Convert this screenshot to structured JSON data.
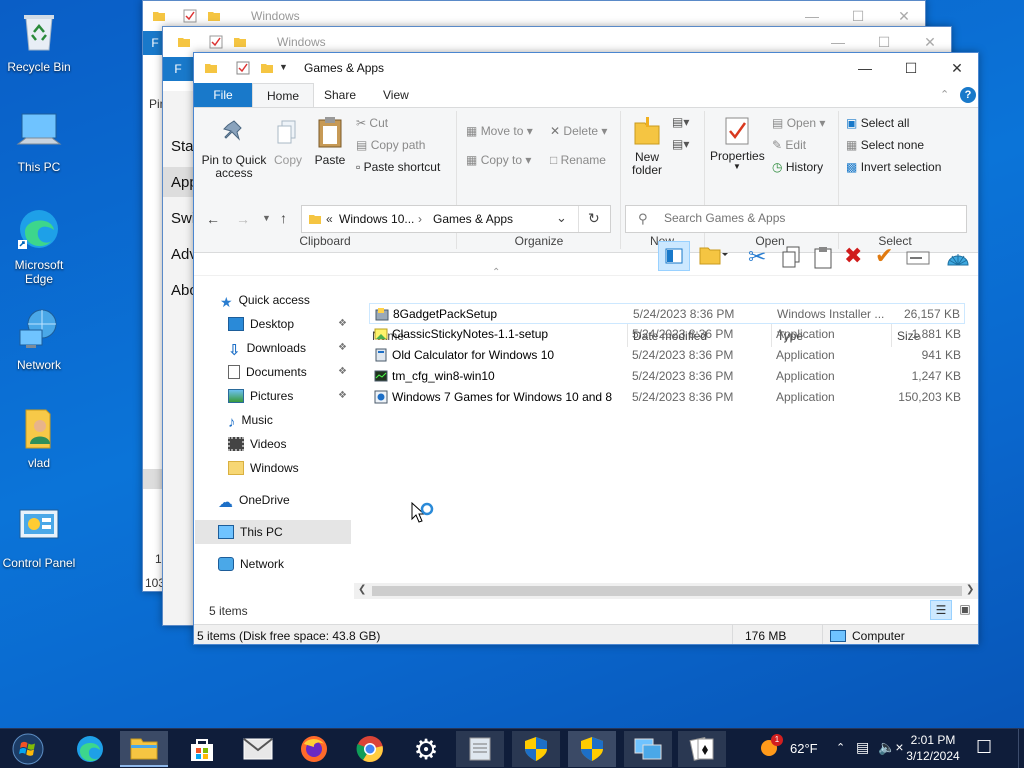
{
  "desktop": {
    "icons": [
      {
        "name": "recycle-bin",
        "label": "Recycle Bin"
      },
      {
        "name": "this-pc",
        "label": "This PC"
      },
      {
        "name": "microsoft-edge",
        "label": "Microsoft Edge"
      },
      {
        "name": "network",
        "label": "Network"
      },
      {
        "name": "vlad",
        "label": "vlad"
      },
      {
        "name": "control-panel",
        "label": "Control Panel"
      }
    ]
  },
  "background_windows": [
    {
      "title": "Windows"
    },
    {
      "title": "Windows"
    }
  ],
  "background_sidebar": {
    "items": [
      "Star",
      "App",
      "Swi",
      "Adv",
      "Abo"
    ],
    "partial_numbers": [
      "1",
      "103"
    ],
    "pin_label": "Pin",
    "file_tab_stub": "F"
  },
  "explorer": {
    "title": "Games & Apps",
    "ribbon_tabs": [
      "File",
      "Home",
      "Share",
      "View"
    ],
    "clipboard": {
      "pin_to_quick_access": "Pin to Quick access",
      "copy": "Copy",
      "paste": "Paste",
      "cut": "Cut",
      "copy_path": "Copy path",
      "paste_shortcut": "Paste shortcut",
      "group_label": "Clipboard"
    },
    "organize": {
      "move_to": "Move to",
      "copy_to": "Copy to",
      "delete": "Delete",
      "rename": "Rename",
      "group_label": "Organize"
    },
    "new": {
      "new_folder": "New folder",
      "group_label": "New"
    },
    "open": {
      "properties": "Properties",
      "open": "Open",
      "edit": "Edit",
      "history": "History",
      "group_label": "Open"
    },
    "select": {
      "select_all": "Select all",
      "select_none": "Select none",
      "invert_selection": "Invert selection",
      "group_label": "Select"
    },
    "address": {
      "prefix": "«",
      "parent": "Windows 10...",
      "separator": "›",
      "current": "Games & Apps"
    },
    "search": {
      "placeholder": "Search Games & Apps"
    },
    "navigation": [
      {
        "name": "quick-access",
        "label": "Quick access",
        "icon": "star-icon"
      },
      {
        "name": "desktop",
        "label": "Desktop",
        "icon": "desktop-icon",
        "pinned": true
      },
      {
        "name": "downloads",
        "label": "Downloads",
        "icon": "download-icon",
        "pinned": true
      },
      {
        "name": "documents",
        "label": "Documents",
        "icon": "document-icon",
        "pinned": true
      },
      {
        "name": "pictures",
        "label": "Pictures",
        "icon": "picture-icon",
        "pinned": true
      },
      {
        "name": "music",
        "label": "Music",
        "icon": "music-icon"
      },
      {
        "name": "videos",
        "label": "Videos",
        "icon": "video-icon"
      },
      {
        "name": "windows",
        "label": "Windows",
        "icon": "folder-icon"
      },
      {
        "name": "onedrive",
        "label": "OneDrive",
        "icon": "cloud-icon"
      },
      {
        "name": "this-pc",
        "label": "This PC",
        "icon": "computer-icon",
        "selected": true
      },
      {
        "name": "network",
        "label": "Network",
        "icon": "network-icon"
      }
    ],
    "columns": [
      "Name",
      "Date modified",
      "Type",
      "Size"
    ],
    "files": [
      {
        "name": "8GadgetPackSetup",
        "date": "5/24/2023 8:36 PM",
        "type": "Windows Installer ...",
        "size": "26,157 KB",
        "icon": "installer-icon",
        "selected": true
      },
      {
        "name": "ClassicStickyNotes-1.1-setup",
        "date": "5/24/2023 8:36 PM",
        "type": "Application",
        "size": "1,881 KB",
        "icon": "setup-icon"
      },
      {
        "name": "Old Calculator for Windows 10",
        "date": "5/24/2023 8:36 PM",
        "type": "Application",
        "size": "941 KB",
        "icon": "calculator-icon"
      },
      {
        "name": "tm_cfg_win8-win10",
        "date": "5/24/2023 8:36 PM",
        "type": "Application",
        "size": "1,247 KB",
        "icon": "task-manager-icon"
      },
      {
        "name": "Windows 7 Games for Windows 10 and 8",
        "date": "5/24/2023 8:36 PM",
        "type": "Application",
        "size": "150,203 KB",
        "icon": "games-icon"
      }
    ],
    "item_count": "5 items",
    "status": {
      "left": "5 items (Disk free space: 43.8 GB)",
      "size": "176 MB",
      "location": "Computer"
    }
  },
  "taskbar": {
    "weather": "62°F",
    "time": "2:01 PM",
    "date": "3/12/2024",
    "notification_badge": "1"
  },
  "colors": {
    "accent": "#1979ca",
    "selection": "#cce8ff",
    "taskbar": "#0f1d3a"
  }
}
